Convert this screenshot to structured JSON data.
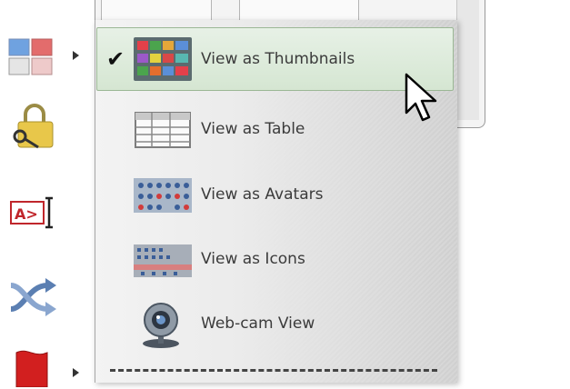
{
  "menu": {
    "items": [
      {
        "label": "View as Thumbnails",
        "checked": true,
        "icon": "thumbnails-icon"
      },
      {
        "label": "View as Table",
        "checked": false,
        "icon": "table-icon"
      },
      {
        "label": "View as Avatars",
        "checked": false,
        "icon": "avatars-icon"
      },
      {
        "label": "View as Icons",
        "checked": false,
        "icon": "icons-view-icon"
      },
      {
        "label": "Web-cam View",
        "checked": false,
        "icon": "webcam-icon"
      }
    ],
    "check_mark": "✔"
  },
  "toolbar": {
    "icons": [
      "layout-grid-icon",
      "lock-key-icon",
      "text-rename-icon",
      "shuffle-arrows-icon",
      "red-flag-icon"
    ],
    "rename_icon_text": "A>"
  },
  "colors": {
    "selected_bg": "#d5e6d2",
    "selected_border": "#9bb795",
    "text": "#3b3b3b"
  }
}
